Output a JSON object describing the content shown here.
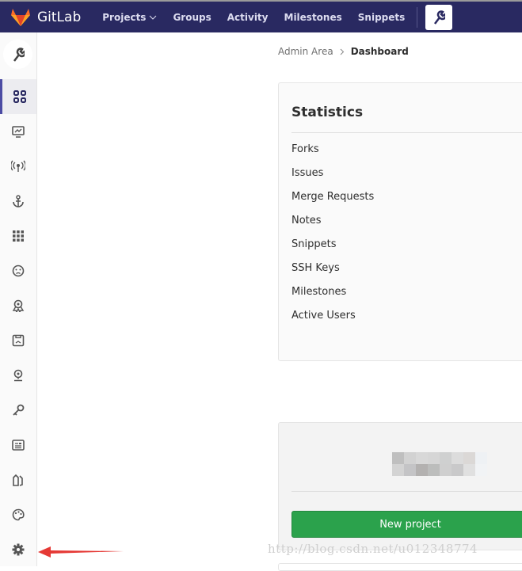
{
  "navbar": {
    "brand": "GitLab",
    "links": [
      "Projects",
      "Groups",
      "Activity",
      "Milestones",
      "Snippets"
    ],
    "admin_icon": "wrench-icon"
  },
  "sidebar": {
    "icons": [
      "overview-grid-icon",
      "monitoring-icon",
      "broadcast-icon",
      "anchor-hooks-icon",
      "applications-icon",
      "abuse-reports-icon",
      "license-icon",
      "kubernetes-icon",
      "geo-icon",
      "deploy-keys-icon",
      "service-templates-icon",
      "labels-icon",
      "appearance-icon",
      "settings-icon"
    ],
    "accent": "#4b4ba3"
  },
  "breadcrumb": {
    "parent": "Admin Area",
    "current": "Dashboard"
  },
  "statistics": {
    "title": "Statistics",
    "rows": [
      "Forks",
      "Issues",
      "Merge Requests",
      "Notes",
      "Snippets",
      "SSH Keys",
      "Milestones",
      "Active Users"
    ]
  },
  "projects_panel": {
    "button": "New project",
    "button_color": "#2ba24c"
  },
  "watermark": "http://blog.csdn.net/u012348774",
  "annotation": {
    "arrow_color": "#e53935"
  }
}
